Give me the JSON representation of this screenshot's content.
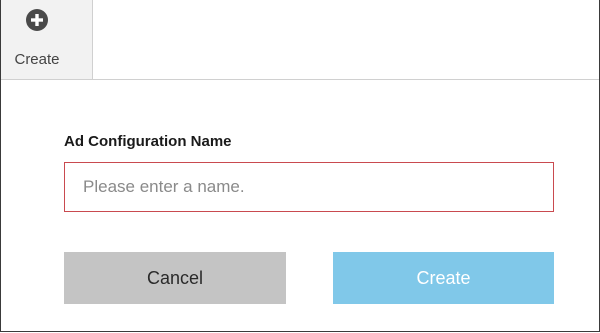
{
  "toolbar": {
    "create_label": "Create",
    "create_icon": "plus-circle-icon"
  },
  "form": {
    "field_label": "Ad Configuration Name",
    "name_value": "",
    "name_placeholder": "Please enter a name.",
    "cancel_label": "Cancel",
    "create_label": "Create"
  },
  "colors": {
    "input_error_border": "#c94a4f",
    "cancel_bg": "#c4c4c4",
    "create_bg": "#80c8e9",
    "toolbar_button_bg": "#f2f2f2"
  }
}
